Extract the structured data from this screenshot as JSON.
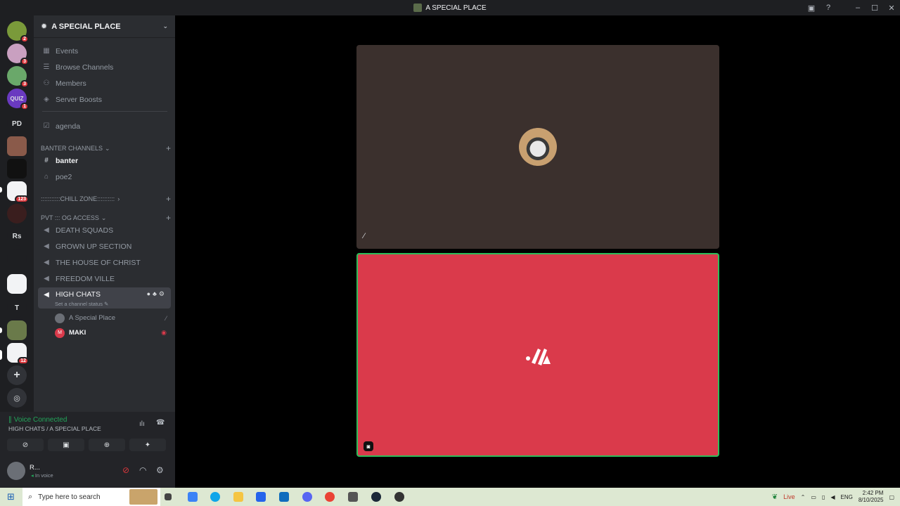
{
  "window": {
    "title": "A SPECIAL PLACE"
  },
  "guilds": [
    {
      "label": "",
      "badge": "2"
    },
    {
      "label": "",
      "badge": "3"
    },
    {
      "label": "",
      "badge": "3"
    },
    {
      "label": "QUIZ",
      "badge": "1"
    },
    {
      "label": "PD",
      "badge": ""
    },
    {
      "label": "",
      "badge": ""
    },
    {
      "label": "",
      "badge": ""
    },
    {
      "label": "",
      "badge": "123"
    },
    {
      "label": "",
      "badge": ""
    },
    {
      "label": "Rs",
      "badge": ""
    },
    {
      "label": "",
      "badge": ""
    },
    {
      "label": "",
      "badge": ""
    },
    {
      "label": "T",
      "badge": ""
    },
    {
      "label": "",
      "badge": ""
    },
    {
      "label": "",
      "badge": "12"
    }
  ],
  "server": {
    "name": "A SPECIAL PLACE",
    "menu": [
      "Events",
      "Browse Channels",
      "Members",
      "Server Boosts"
    ],
    "agenda": "agenda",
    "categories": {
      "banter": "BANTER CHANNELS",
      "chill": ":::::::::::CHILL ZONE::::::::::",
      "pvt": "PVT ::: OG ACCESS"
    },
    "banter_channels": [
      "banter",
      "poe2"
    ],
    "voice_channels": [
      "DEATH SQUADS",
      "GROWN UP SECTION",
      "THE HOUSE OF CHRIST",
      "FREEDOM VILLE",
      "HIGH CHATS"
    ],
    "channel_status": "Set a channel status",
    "voice_users": [
      "A Special Place",
      "MAKI"
    ]
  },
  "voice": {
    "status": "Voice Connected",
    "path": "HIGH CHATS / A SPECIAL PLACE"
  },
  "user": {
    "name": "R...",
    "status": "In voice"
  },
  "taskbar": {
    "search_placeholder": "Type here to search",
    "live": "Live",
    "lang": "ENG",
    "time": "2:42 PM",
    "date": "8/10/2025"
  }
}
